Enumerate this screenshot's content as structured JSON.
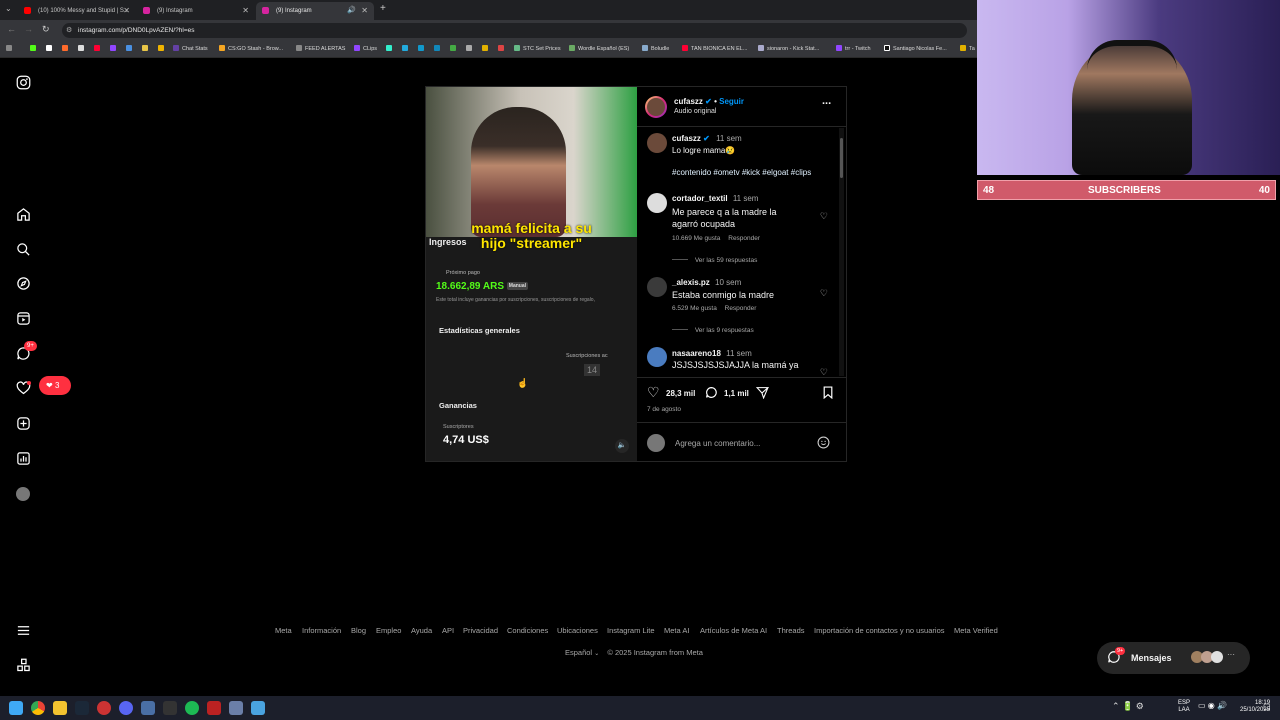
{
  "browser": {
    "tabs": [
      {
        "title": "(10) 100% Messy and Stupid | S...",
        "color": "#ff0000"
      },
      {
        "title": "(9) Instagram",
        "color": "#d6249f"
      },
      {
        "title": "(9) Instagram",
        "color": "#d6249f"
      }
    ],
    "new_tab": "+",
    "url": "instagram.com/p/DND0LpvAZEN/?hl=es",
    "bookmarks": [
      "Chat Stats",
      "CS:GO Stash - Brow...",
      "FEED ALERTAS",
      "CLips",
      "STC Set Prices",
      "Wordle Español (ES)",
      "Boludle",
      "TAN BIONICA EN EL...",
      "sionaron - Kick Stat...",
      "trr - Twitch",
      "Santiago Nicolas Fe...",
      "Ta"
    ]
  },
  "sidebar": {
    "logo": "instagram-icon",
    "items": [
      "home-icon",
      "search-icon",
      "explore-icon",
      "reels-icon",
      "messages-icon",
      "notifications-icon",
      "create-icon",
      "dashboard-icon",
      "profile-icon"
    ],
    "messages_badge": "9+",
    "notif_badge": "3",
    "more": "menu-icon",
    "also": "apps-icon"
  },
  "media": {
    "caption_line1": "mamá felicita a su",
    "caption_line2": "hijo \"streamer\"",
    "ingresos": "Ingresos",
    "proximo_pago": "Próximo pago",
    "amount": "18.662,89 ARS",
    "manual": "Manual",
    "note": "Este total incluye ganancias por suscripciones, suscripciones de regalo,",
    "estadisticas": "Estadísticas generales",
    "suscripciones_label": "Suscripciones ac",
    "suscripciones_value": "14",
    "ganancias": "Ganancias",
    "suscriptores": "Suscriptores",
    "usd": "4,74 US$"
  },
  "post": {
    "author": "cufaszz",
    "follow": "Seguir",
    "audio": "Audio original",
    "more": "...",
    "caption_author": "cufaszz",
    "caption_time": "11 sem",
    "caption_text": "Lo logre mama😢",
    "hashtags": "#contenido #ometv #kick #elgoat #clips",
    "comments": [
      {
        "user": "cortador_textil",
        "time": "11 sem",
        "text": "Me parece q a la madre la agarró ocupada",
        "likes": "10.669 Me gusta",
        "reply": "Responder",
        "replies": "Ver las 59 respuestas"
      },
      {
        "user": "_alexis.pz",
        "time": "10 sem",
        "text": "Estaba conmigo la madre",
        "likes": "6.529 Me gusta",
        "reply": "Responder",
        "replies": "Ver las 9 respuestas"
      },
      {
        "user": "nasaareno18",
        "time": "11 sem",
        "text": "JSJSJSJSJSJAJJA la mamá ya",
        "likes": "",
        "reply": "",
        "replies": ""
      }
    ],
    "like_count": "28,3 mil",
    "comment_count": "1,1 mil",
    "date": "7 de agosto",
    "comment_placeholder": "Agrega un comentario..."
  },
  "footer": {
    "links": [
      "Meta",
      "Información",
      "Blog",
      "Empleo",
      "Ayuda",
      "API",
      "Privacidad",
      "Condiciones",
      "Ubicaciones",
      "Instagram Lite",
      "Meta AI",
      "Artículos de Meta AI",
      "Threads",
      "Importación de contactos y no usuarios",
      "Meta Verified"
    ],
    "language": "Español",
    "copyright": "© 2025 Instagram from Meta"
  },
  "messages_widget": {
    "label": "Mensajes",
    "badge": "9+"
  },
  "overlay": {
    "left_count": "48",
    "label": "SUBSCRIBERS",
    "right_count": "40"
  },
  "taskbar": {
    "lang1": "ESP",
    "lang2": "LAA",
    "time": "18:19",
    "date": "25/10/2025"
  }
}
